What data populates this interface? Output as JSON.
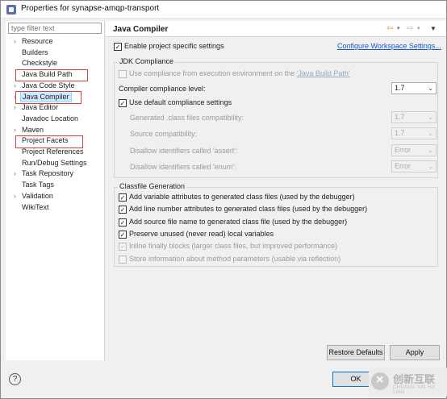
{
  "window": {
    "title": "Properties for synapse-amqp-transport"
  },
  "filter": {
    "placeholder": "type filter text"
  },
  "tree": [
    {
      "label": "Resource",
      "expandable": true
    },
    {
      "label": "Builders",
      "expandable": false
    },
    {
      "label": "Checkstyle",
      "expandable": false
    },
    {
      "label": "Java Build Path",
      "expandable": false
    },
    {
      "label": "Java Code Style",
      "expandable": true
    },
    {
      "label": "Java Compiler",
      "expandable": true,
      "selected": true
    },
    {
      "label": "Java Editor",
      "expandable": true
    },
    {
      "label": "Javadoc Location",
      "expandable": false
    },
    {
      "label": "Maven",
      "expandable": true
    },
    {
      "label": "Project Facets",
      "expandable": false
    },
    {
      "label": "Project References",
      "expandable": false
    },
    {
      "label": "Run/Debug Settings",
      "expandable": false
    },
    {
      "label": "Task Repository",
      "expandable": true
    },
    {
      "label": "Task Tags",
      "expandable": false
    },
    {
      "label": "Validation",
      "expandable": true
    },
    {
      "label": "WikiText",
      "expandable": false
    }
  ],
  "page": {
    "title": "Java Compiler",
    "enable_specific": "Enable project specific settings",
    "configure_link": "Configure Workspace Settings...",
    "jdk_group": "JDK Compliance",
    "use_compliance_prefix": "Use compliance from execution environment on the ",
    "use_compliance_link": "'Java Build Path'",
    "compliance_level_label": "Compiler compliance level:",
    "compliance_level_value": "1.7",
    "use_default": "Use default compliance settings",
    "generated_label": "Generated .class files compatibility:",
    "generated_value": "1.7",
    "source_label": "Source compatibility:",
    "source_value": "1.7",
    "assert_label": "Disallow identifiers called 'assert':",
    "assert_value": "Error",
    "enum_label": "Disallow identifiers called 'enum':",
    "enum_value": "Error",
    "classfile_group": "Classfile Generation",
    "classfile_options": [
      {
        "label": "Add variable attributes to generated class files (used by the debugger)",
        "checked": true,
        "enabled": true
      },
      {
        "label": "Add line number attributes to generated class files (used by the debugger)",
        "checked": true,
        "enabled": true
      },
      {
        "label": "Add source file name to generated class file (used by the debugger)",
        "checked": true,
        "enabled": true
      },
      {
        "label": "Preserve unused (never read) local variables",
        "checked": true,
        "enabled": true
      },
      {
        "label": "Inline finally blocks (larger class files, but improved performance)",
        "checked": true,
        "enabled": false
      },
      {
        "label": "Store information about method parameters (usable via reflection)",
        "checked": false,
        "enabled": false
      }
    ],
    "restore_defaults": "Restore Defaults",
    "apply": "Apply"
  },
  "footer": {
    "help": "?",
    "ok": "OK"
  },
  "watermark": {
    "text": "创新互联",
    "sub": "CHUANG XIN HU LIAN"
  },
  "colors": {
    "selection": "#cde8ff",
    "highlight_box": "#e33b3b",
    "link": "#1a57c2"
  }
}
